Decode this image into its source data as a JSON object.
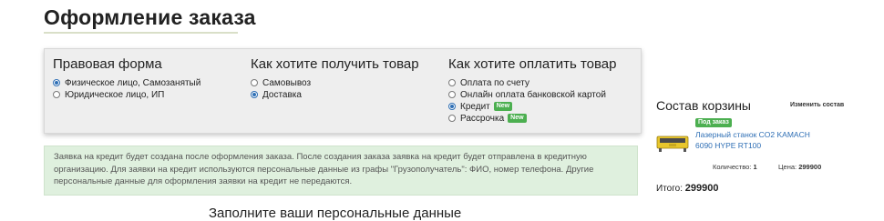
{
  "page": {
    "title": "Оформление заказа"
  },
  "legal_form": {
    "heading": "Правовая форма",
    "options": [
      {
        "label": "Физическое лицо, Самозанятый",
        "checked": true
      },
      {
        "label": "Юридическое лицо, ИП",
        "checked": false
      }
    ]
  },
  "delivery": {
    "heading": "Как хотите получить товар",
    "options": [
      {
        "label": "Самовывоз",
        "checked": false
      },
      {
        "label": "Доставка",
        "checked": true
      }
    ]
  },
  "payment": {
    "heading": "Как хотите оплатить товар",
    "options": [
      {
        "label": "Оплата по счету",
        "checked": false,
        "badge": ""
      },
      {
        "label": "Онлайн оплата банковской картой",
        "checked": false,
        "badge": ""
      },
      {
        "label": "Кредит",
        "checked": true,
        "badge": "New"
      },
      {
        "label": "Рассрочка",
        "checked": false,
        "badge": "New"
      }
    ]
  },
  "info": {
    "text": "Заявка на кредит будет создана после оформления заказа. После создания заказа заявка на кредит будет отправлена в кредитную организацию. Для заявки на кредит используются персональные данные из графы \"Грузополучатель\": ФИО, номер телефона. Другие персональные данные для оформления заявки на кредит не передаются."
  },
  "personal": {
    "heading": "Заполните ваши персональные данные"
  },
  "cart": {
    "title": "Состав корзины",
    "edit_label": "Изменить состав",
    "item": {
      "badge": "Под заказ",
      "name": "Лазерный станок CO2 KAMACH 6090 HYPE RT100",
      "quantity_label": "Количество:",
      "quantity": "1",
      "price_label": "Цена:",
      "price": "299900"
    },
    "total_label": "Итого:",
    "total": "299900"
  },
  "colors": {
    "accent_green": "#4caf50",
    "link_blue": "#2f6fb5",
    "info_bg": "#dff0de"
  }
}
